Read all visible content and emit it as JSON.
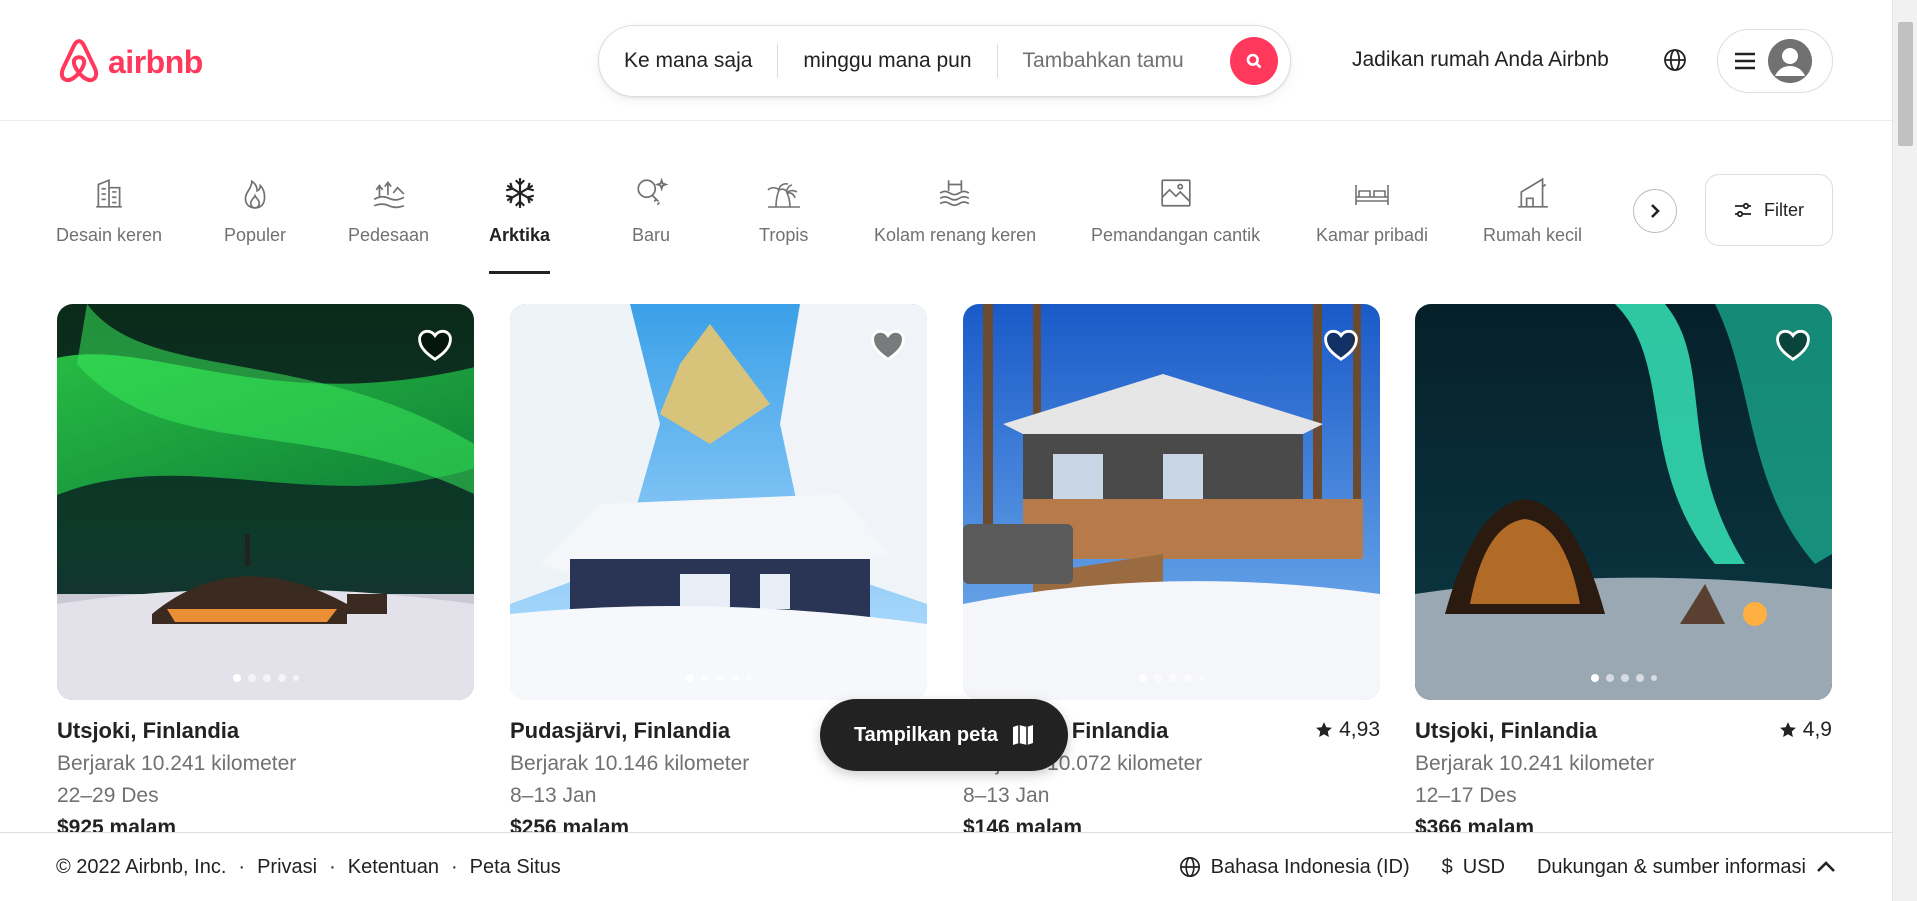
{
  "brand": {
    "name": "airbnb",
    "color": "#ff385c"
  },
  "search": {
    "where": "Ke mana saja",
    "when": "minggu mana pun",
    "guests_placeholder": "Tambahkan tamu"
  },
  "header": {
    "host_link": "Jadikan rumah Anda Airbnb"
  },
  "categories": [
    {
      "label": "Desain keren",
      "icon": "building-icon"
    },
    {
      "label": "Populer",
      "icon": "flame-icon"
    },
    {
      "label": "Pedesaan",
      "icon": "countryside-icon"
    },
    {
      "label": "Arktika",
      "icon": "snowflake-icon",
      "active": true
    },
    {
      "label": "Baru",
      "icon": "sparkle-key-icon"
    },
    {
      "label": "Tropis",
      "icon": "palm-tree-icon"
    },
    {
      "label": "Kolam renang keren",
      "icon": "pool-icon"
    },
    {
      "label": "Pemandangan cantik",
      "icon": "scenic-view-icon"
    },
    {
      "label": "Kamar pribadi",
      "icon": "bed-icon"
    },
    {
      "label": "Rumah kecil",
      "icon": "tiny-house-icon"
    }
  ],
  "filter_label": "Filter",
  "listings": [
    {
      "location": "Utsjoki, Finlandia",
      "distance": "Berjarak 10.241 kilometer",
      "dates": "22–29 Des",
      "price": "$925 malam",
      "rating": ""
    },
    {
      "location": "Pudasjärvi, Finlandia",
      "distance": "Berjarak 10.146 kilometer",
      "dates": "8–13 Jan",
      "price": "$256 malam",
      "rating": ""
    },
    {
      "location": "Salmi KK, Finlandia",
      "distance": "Berjarak 10.072 kilometer",
      "dates": "8–13 Jan",
      "price": "$146 malam",
      "rating": "4,93"
    },
    {
      "location": "Utsjoki, Finlandia",
      "distance": "Berjarak 10.241 kilometer",
      "dates": "12–17 Des",
      "price": "$366 malam",
      "rating": "4,9"
    }
  ],
  "map_button": "Tampilkan peta",
  "footer": {
    "copyright": "© 2022 Airbnb, Inc.",
    "links": [
      "Privasi",
      "Ketentuan",
      "Peta Situs"
    ],
    "language": "Bahasa Indonesia (ID)",
    "currency_symbol": "$",
    "currency": "USD",
    "support": "Dukungan & sumber informasi"
  }
}
